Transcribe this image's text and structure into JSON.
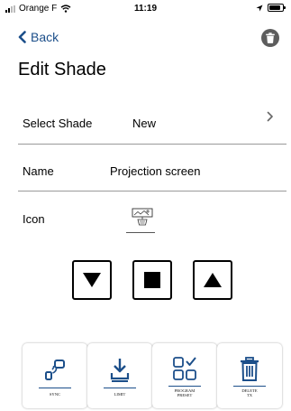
{
  "status_bar": {
    "carrier": "Orange F",
    "time": "11:19",
    "battery_level": 0.85
  },
  "nav": {
    "back_label": "Back"
  },
  "page": {
    "title": "Edit Shade"
  },
  "form": {
    "select_shade": {
      "label": "Select Shade",
      "value": "New"
    },
    "name": {
      "label": "Name",
      "value": "Projection screen"
    },
    "icon": {
      "label": "Icon",
      "value_icon": "projection-screen-icon"
    }
  },
  "controls": [
    "down-arrow",
    "stop",
    "up-arrow"
  ],
  "actions": [
    {
      "label": "SYNC",
      "icon": "sync-icon"
    },
    {
      "label": "LIMIT",
      "icon": "limit-icon"
    },
    {
      "label": "PROGRAM PRESET",
      "line1": "PROGRAM",
      "line2": "PRESET",
      "icon": "program-preset-icon"
    },
    {
      "label": "DELETE TX",
      "line1": "DELETE",
      "line2": "TX",
      "icon": "delete-tx-icon"
    }
  ],
  "colors": {
    "accent": "#1c4f8a",
    "divider": "#9a9a9a",
    "trash_bg": "#5d5d5d"
  }
}
